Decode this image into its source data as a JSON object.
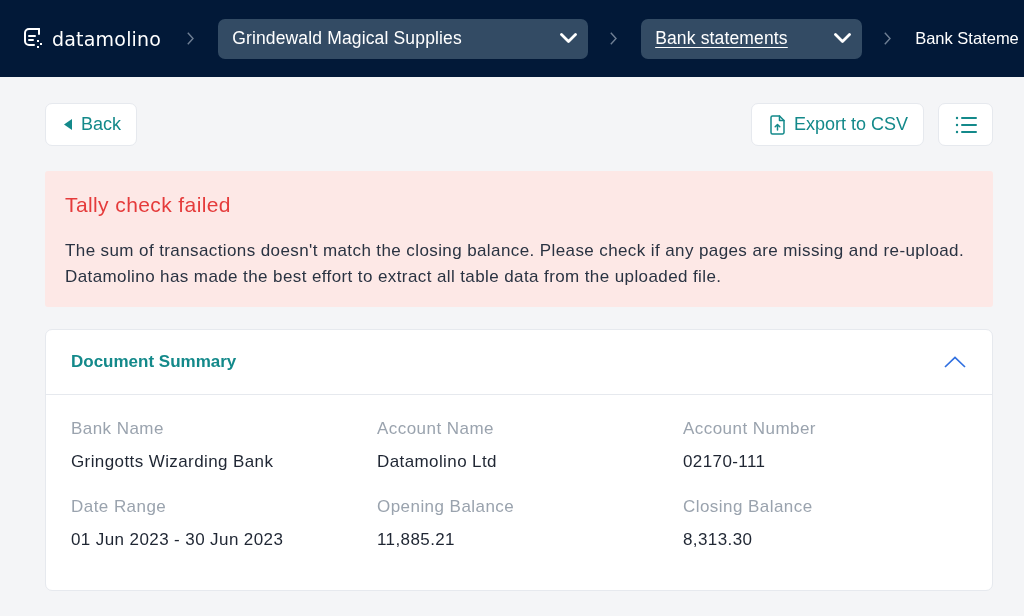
{
  "header": {
    "logo": {
      "text": "datamolino"
    },
    "breadcrumbs": [
      {
        "kind": "dropdown",
        "label": "Grindewald Magical Supplies",
        "hovered": false
      },
      {
        "kind": "dropdown",
        "label": "Bank statements",
        "hovered": true
      },
      {
        "kind": "text",
        "label": "Bank Stateme"
      }
    ]
  },
  "toolbar": {
    "back_button": "Back",
    "export_button": "Export to CSV"
  },
  "alert": {
    "title": "Tally check failed",
    "lines": [
      "The sum of transactions doesn't match the closing balance. Please check if any pages are missing and re-upload.",
      "Datamolino has made the best effort to extract all table data from the uploaded file."
    ]
  },
  "summary": {
    "title": "Document Summary",
    "expanded": true,
    "fields": [
      {
        "label": "Bank Name",
        "value": "Gringotts Wizarding Bank"
      },
      {
        "label": "Account Name",
        "value": "Datamolino Ltd"
      },
      {
        "label": "Account Number",
        "value": "02170-111"
      },
      {
        "label": "Date Range",
        "value": "01 Jun 2023 - 30 Jun 2023"
      },
      {
        "label": "Opening Balance",
        "value": "11,885.21"
      },
      {
        "label": "Closing Balance",
        "value": "8,313.30"
      }
    ]
  }
}
